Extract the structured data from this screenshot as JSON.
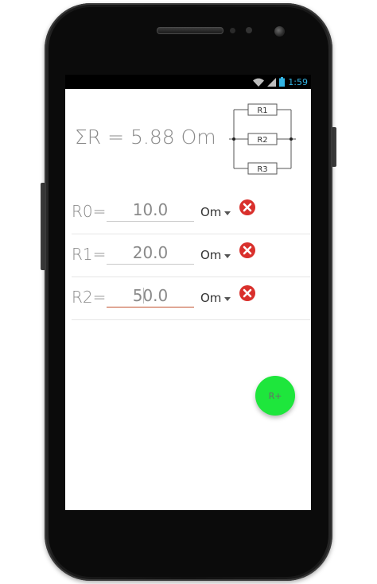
{
  "status_bar": {
    "time": "1:59",
    "icons": [
      "wifi-icon",
      "signal-icon",
      "battery-icon"
    ],
    "time_color": "#33b5e5"
  },
  "summary": {
    "total_label": "ΣR = 5.88 Om"
  },
  "diagram": {
    "resistors": [
      "R1",
      "R2",
      "R3"
    ]
  },
  "resistors": [
    {
      "label": "R0=",
      "value": "10.0",
      "unit": "Om",
      "active": false
    },
    {
      "label": "R1=",
      "value": "20.0",
      "unit": "Om",
      "active": false
    },
    {
      "label": "R2=",
      "value": "50.0",
      "unit": "Om",
      "active": true
    }
  ],
  "fab": {
    "label": "R+",
    "color": "#1ee63c"
  },
  "colors": {
    "remove_red": "#d9302c",
    "active_underline": "#c1502c"
  }
}
